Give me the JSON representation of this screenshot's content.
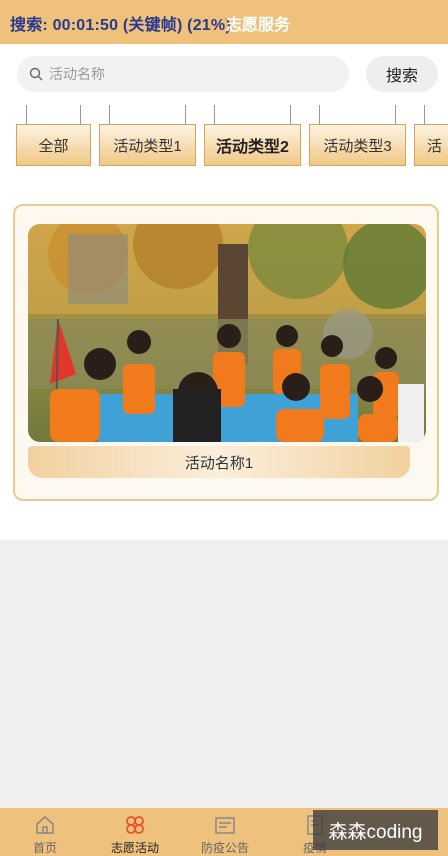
{
  "header": {
    "overlay_text": "搜索: 00:01:50 (关键帧) (21%)",
    "title": "志愿服务"
  },
  "search": {
    "placeholder": "活动名称",
    "button_label": "搜索"
  },
  "tabs": [
    {
      "label": "全部"
    },
    {
      "label": "活动类型1"
    },
    {
      "label": "活动类型2",
      "active": true
    },
    {
      "label": "活动类型3"
    },
    {
      "label": "活"
    }
  ],
  "activities": [
    {
      "name": "活动名称1"
    }
  ],
  "bottom_nav": [
    {
      "label": "首页",
      "icon": "home-icon"
    },
    {
      "label": "志愿活动",
      "icon": "activity-icon",
      "active": true
    },
    {
      "label": "防疫公告",
      "icon": "notice-icon"
    },
    {
      "label": "疫情",
      "icon": "report-icon"
    }
  ],
  "watermark": "森森coding",
  "colors": {
    "accent": "#efc17a",
    "active_icon": "#e8532f"
  }
}
